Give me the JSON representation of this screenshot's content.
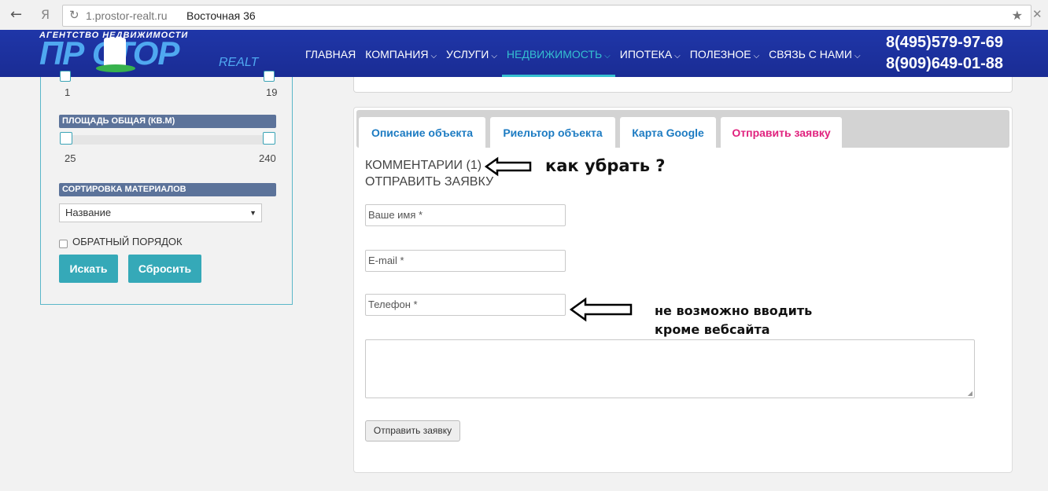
{
  "browser": {
    "back_icon": "←",
    "yandex_icon": "Я",
    "domain": "1.prostor-realt.ru",
    "page_title": "Восточная 36",
    "reload_icon": "↻",
    "star_icon": "★",
    "close_icon": "✕"
  },
  "header": {
    "logo_top": "АГЕНТСТВО НЕДВИЖИМОСТИ",
    "logo_main": "ПР СТОР",
    "logo_sub": "REALT",
    "nav": [
      {
        "label": "ГЛАВНАЯ",
        "chevron": ""
      },
      {
        "label": "КОМПАНИЯ",
        "chevron": "⌵"
      },
      {
        "label": "УСЛУГИ",
        "chevron": "⌵"
      },
      {
        "label": "НЕДВИЖИМОСТЬ",
        "chevron": "⌵"
      },
      {
        "label": "ИПОТЕКА",
        "chevron": "⌵"
      },
      {
        "label": "ПОЛЕЗНОЕ",
        "chevron": "⌵"
      },
      {
        "label": "СВЯЗЬ С НАМИ",
        "chevron": "⌵"
      }
    ],
    "phone1": "8(495)579-97-69",
    "phone2": "8(909)649-01-88",
    "colors": {
      "header_bg": "#1f36a8",
      "active_nav": "#35c0d0",
      "logo": "#4fa8f0"
    }
  },
  "filters": {
    "range1_min": "1",
    "range1_max": "19",
    "area_label": "ПЛОЩАДЬ ОБЩАЯ (КВ.М)",
    "area_min": "25",
    "area_max": "240",
    "sort_label": "СОРТИРОВКА МАТЕРИАЛОВ",
    "sort_value": "Название",
    "sort_arrow": "▼",
    "reverse_label": "ОБРАТНЫЙ ПОРЯДОК",
    "reverse_checked": false,
    "search_button": "Искать",
    "reset_button": "Сбросить",
    "accent": "#35a9b8"
  },
  "tabs": [
    {
      "label": "Описание объекта",
      "active": false
    },
    {
      "label": "Риельтор объекта",
      "active": false
    },
    {
      "label": "Карта Google",
      "active": false
    },
    {
      "label": "Отправить заявку",
      "active": true
    }
  ],
  "form": {
    "comments_heading": "КОММЕНТАРИИ (1)",
    "send_heading": "ОТПРАВИТЬ ЗАЯВКУ",
    "name_placeholder": "Ваше имя *",
    "email_placeholder": "E-mail *",
    "phone_placeholder": "Телефон *",
    "message_value": "",
    "submit_label": "Отправить заявку"
  },
  "annotations": {
    "note1": "как убрать ?",
    "note2_line1": "не возможно вводить",
    "note2_line2": "кроме вебсайта"
  }
}
